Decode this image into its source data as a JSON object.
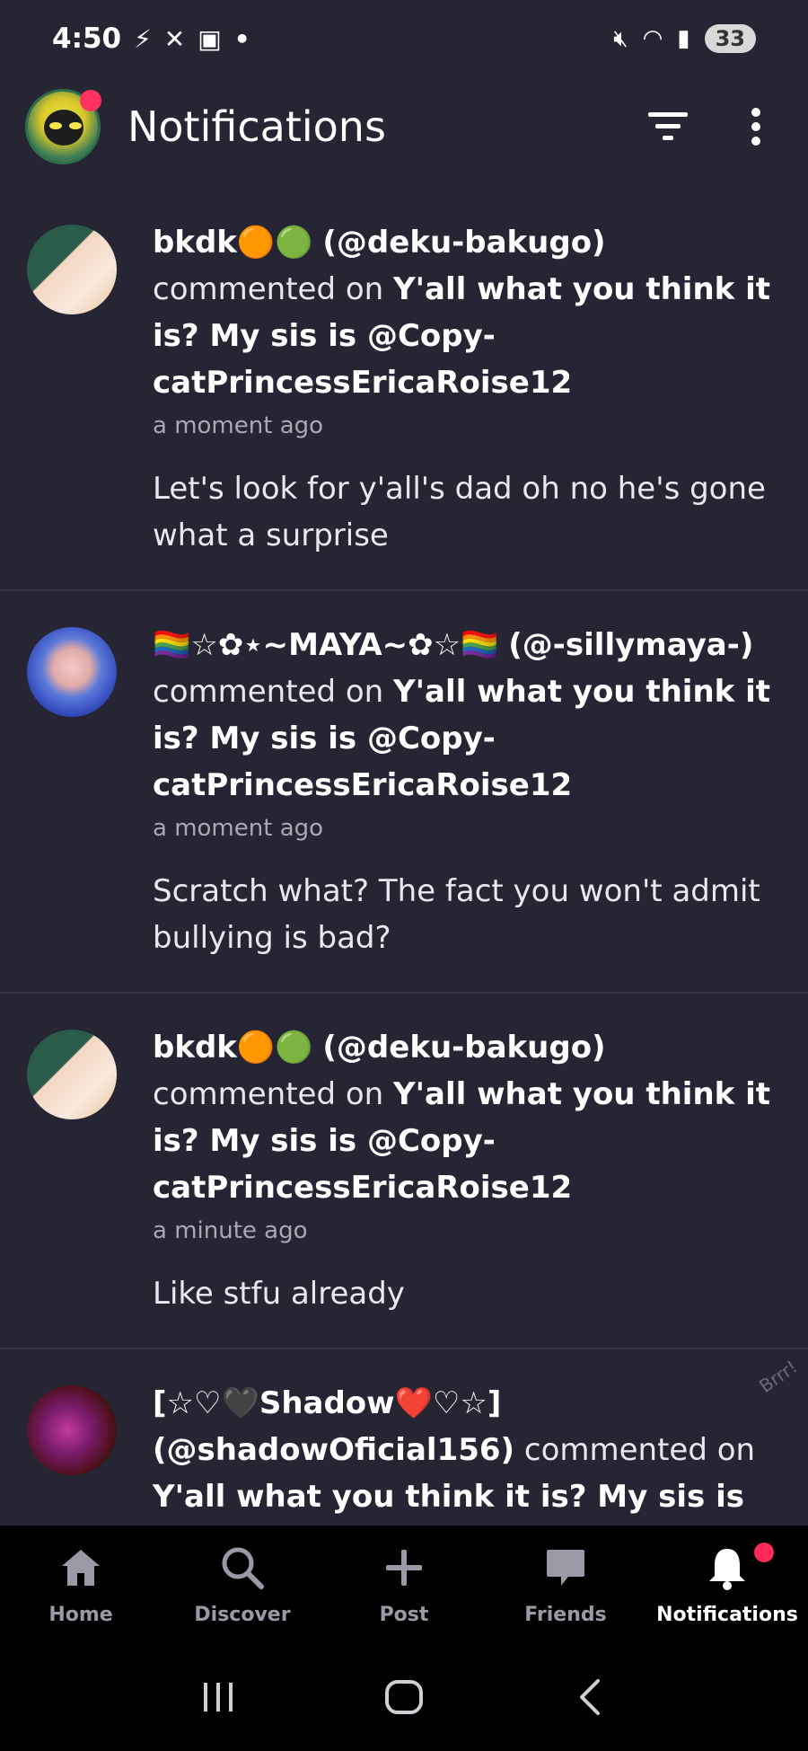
{
  "status_bar": {
    "time": "4:50",
    "left_icons": [
      "bolt-icon",
      "no-calls-icon",
      "calendar-icon",
      "dot-icon"
    ],
    "right_icons": [
      "mute-icon",
      "wifi-icon",
      "signal-icon"
    ],
    "battery": "33"
  },
  "header": {
    "title": "Notifications"
  },
  "notifications": [
    {
      "user": "bkdk🟠🟢",
      "handle": "(@deku-bakugo)",
      "action": "commented on",
      "post": "Y'all what you think it is? My sis is @Copy-catPrincessEricaRoise12",
      "time": "a moment ago",
      "comment": "Let's look for y'all's dad oh no he's gone what a surprise"
    },
    {
      "user": "🏳️‍🌈☆✿⋆~MAYA~✿☆🏳️‍🌈",
      "handle": "(@-sillymaya-)",
      "action": "commented on",
      "post": "Y'all what you think it is? My sis is @Copy-catPrincessEricaRoise12",
      "time": "a moment ago",
      "comment": "Scratch what? The fact you won't admit bullying is bad?"
    },
    {
      "user": "bkdk🟠🟢",
      "handle": "(@deku-bakugo)",
      "action": "commented on",
      "post": "Y'all what you think it is? My sis is @Copy-catPrincessEricaRoise12",
      "time": "a minute ago",
      "comment": "Like stfu already"
    },
    {
      "user": "[☆♡🖤Shadow❤️♡☆]",
      "handle": "(@shadowOficial156)",
      "action": "commented on",
      "post": "Y'all what you think it is? My sis is @Copy-",
      "time": "",
      "comment": ""
    }
  ],
  "watermark": "Brrr!",
  "bottom_nav": [
    {
      "label": "Home",
      "icon": "home-icon"
    },
    {
      "label": "Discover",
      "icon": "search-icon"
    },
    {
      "label": "Post",
      "icon": "plus-icon"
    },
    {
      "label": "Friends",
      "icon": "chat-icon"
    },
    {
      "label": "Notifications",
      "icon": "bell-icon",
      "active": true
    }
  ],
  "colors": {
    "background": "#262533",
    "accent_badge": "#ff2a55",
    "divider": "#3a3948"
  }
}
